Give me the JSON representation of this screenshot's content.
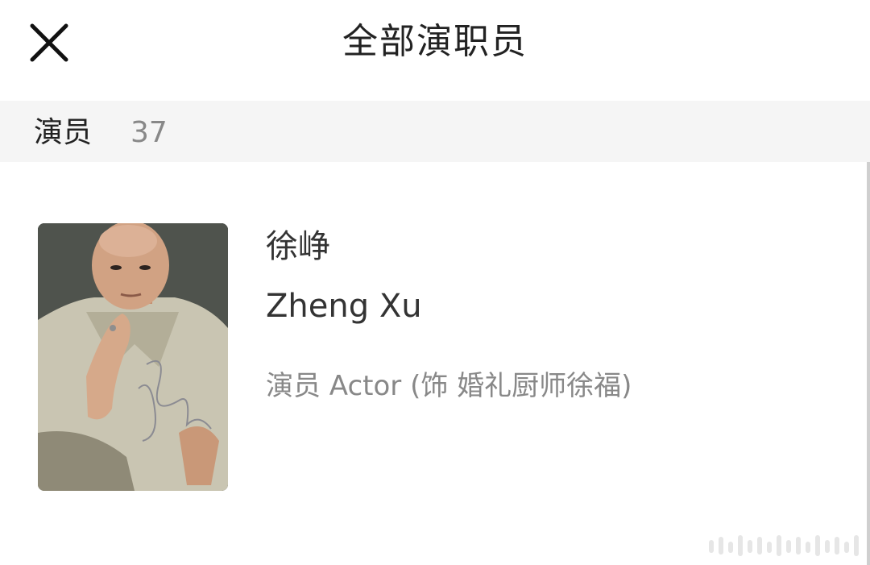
{
  "header": {
    "title": "全部演职员",
    "close_icon": "close-icon"
  },
  "section": {
    "label": "演员",
    "count": "37"
  },
  "cast": [
    {
      "name_cn": "徐峥",
      "name_en": "Zheng Xu",
      "role": "演员 Actor (饰 婚礼厨师徐福)"
    }
  ],
  "colors": {
    "background": "#ffffff",
    "section_bar": "#f5f5f5",
    "title_text": "#222222",
    "secondary_text": "#888888"
  }
}
